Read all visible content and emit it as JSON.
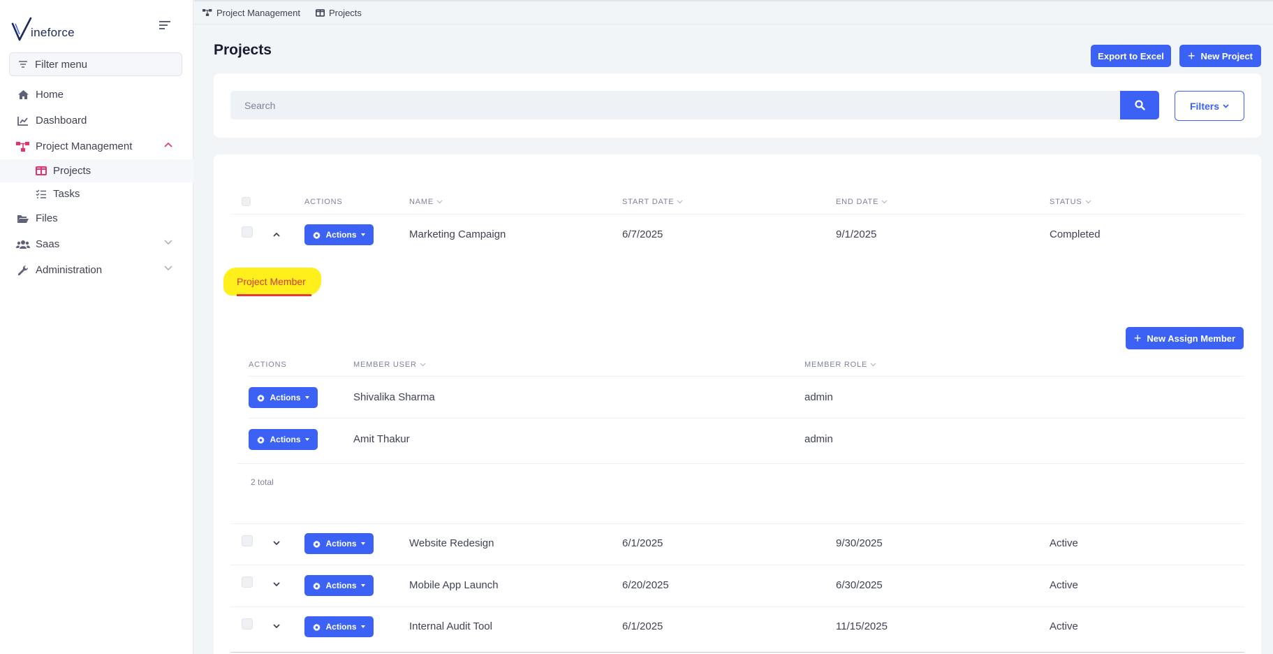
{
  "app": {
    "logo_text": "ineforce",
    "logo_letter": "V"
  },
  "sidebar": {
    "filter_placeholder": "Filter menu",
    "items": [
      {
        "label": "Home",
        "icon": "home-icon"
      },
      {
        "label": "Dashboard",
        "icon": "chart-line-icon"
      },
      {
        "label": "Project Management",
        "icon": "sitemap-icon",
        "expanded": true
      },
      {
        "label": "Files",
        "icon": "folder-open-icon"
      },
      {
        "label": "Saas",
        "icon": "users-icon"
      },
      {
        "label": "Administration",
        "icon": "wrench-icon"
      }
    ],
    "sub_items": [
      {
        "label": "Projects",
        "icon": "table-columns-icon",
        "active": true
      },
      {
        "label": "Tasks",
        "icon": "list-check-icon"
      }
    ]
  },
  "breadcrumb": [
    "Project Management",
    "Projects"
  ],
  "page": {
    "title": "Projects",
    "export_label": "Export to Excel",
    "new_project_label": "New Project"
  },
  "search": {
    "placeholder": "Search",
    "filters_label": "Filters"
  },
  "table": {
    "headers": {
      "actions": "ACTIONS",
      "name": "NAME",
      "start_date": "START DATE",
      "end_date": "END DATE",
      "status": "STATUS"
    },
    "actions_label": "Actions",
    "rows": [
      {
        "name": "Marketing Campaign",
        "start_date": "6/7/2025",
        "end_date": "9/1/2025",
        "status": "Completed",
        "expanded": true
      },
      {
        "name": "Website Redesign",
        "start_date": "6/1/2025",
        "end_date": "9/30/2025",
        "status": "Active"
      },
      {
        "name": "Mobile App Launch",
        "start_date": "6/20/2025",
        "end_date": "6/30/2025",
        "status": "Active"
      },
      {
        "name": "Internal Audit Tool",
        "start_date": "6/1/2025",
        "end_date": "11/15/2025",
        "status": "Active"
      }
    ]
  },
  "members": {
    "tab_label": "Project Member",
    "new_assign_label": "New Assign Member",
    "headers": {
      "actions": "ACTIONS",
      "member_user": "MEMBER USER",
      "member_role": "MEMBER ROLE"
    },
    "rows": [
      {
        "user": "Shivalika Sharma",
        "role": "admin"
      },
      {
        "user": "Amit Thakur",
        "role": "admin"
      }
    ],
    "total": "2 total"
  },
  "colors": {
    "primary": "#3b62f5",
    "brand_pink": "#e2336b",
    "highlight": "#ffef1a"
  }
}
